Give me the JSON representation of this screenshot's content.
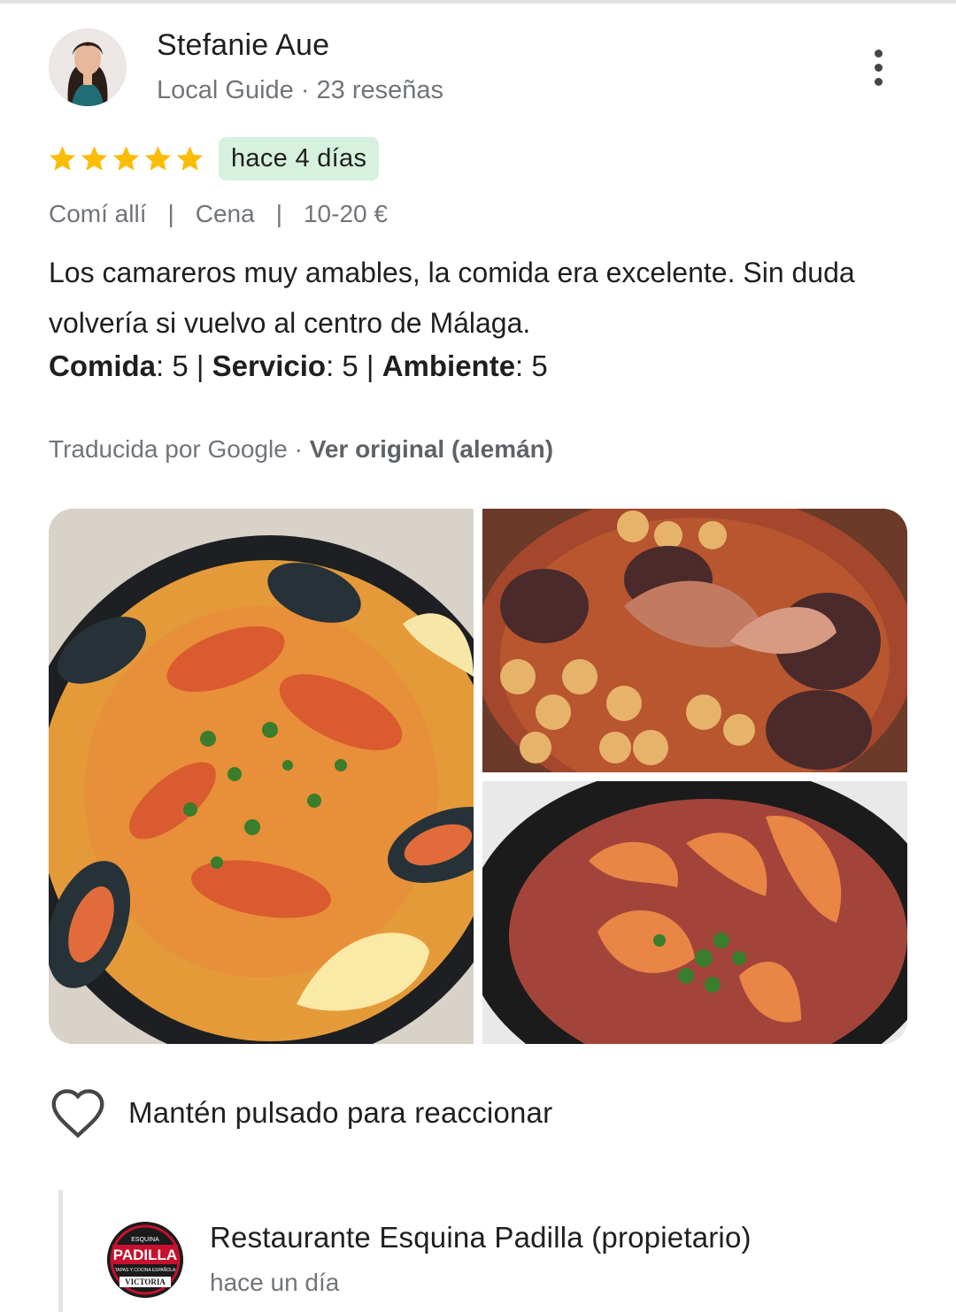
{
  "review": {
    "author": {
      "name": "Stefanie Aue",
      "meta": "Local Guide · 23 reseñas"
    },
    "rating": 5,
    "rating_max": 5,
    "date_badge": "hace 4 días",
    "details": [
      "Comí allí",
      "Cena",
      "10-20 €"
    ],
    "details_separator": "|",
    "text": "Los camareros muy amables, la comida era excelente. Sin duda volvería si vuelvo al centro de Málaga.",
    "aspect_ratings": [
      {
        "label": "Comida",
        "value": "5"
      },
      {
        "label": "Servicio",
        "value": "5"
      },
      {
        "label": "Ambiente",
        "value": "5"
      }
    ],
    "translation": {
      "note": "Traducida por Google",
      "dot": " · ",
      "link": "Ver original (alemán)"
    },
    "react_label": "Mantén pulsado para reaccionar"
  },
  "owner_reply": {
    "name": "Restaurante Esquina Padilla (propietario)",
    "time": "hace un día",
    "logo_text": [
      "ESQUINA",
      "PADILLA",
      "TAPAS Y COCINA ESPAÑOLA",
      "VICTORIA"
    ]
  },
  "colors": {
    "star": "#fbbc04",
    "badge_bg": "#d6f1de",
    "muted_text": "#70757a",
    "logo_red": "#c8102e"
  },
  "icons": {
    "menu": "more-vert-icon",
    "star": "star-icon",
    "react": "heart-outline-icon"
  }
}
